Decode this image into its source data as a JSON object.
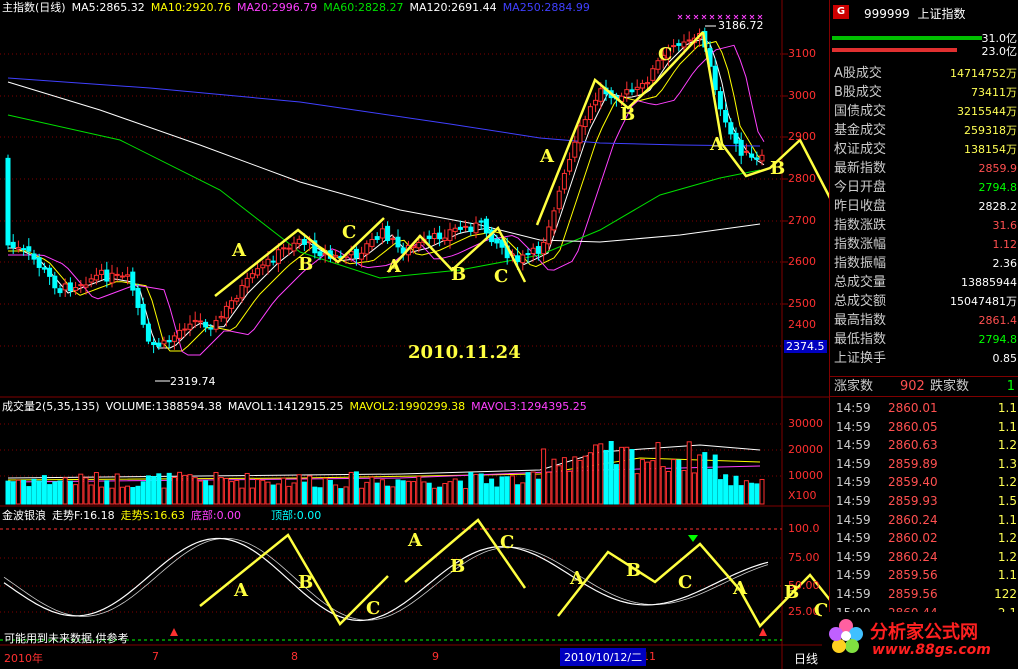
{
  "header": {
    "title": "主指数(日线)",
    "ma5": "MA5:2865.32",
    "ma10": "MA10:2920.76",
    "ma20": "MA20:2996.79",
    "ma60": "MA60:2828.27",
    "ma120": "MA120:2691.44",
    "ma250": "MA250:2884.99"
  },
  "price_axis": [
    "3100",
    "3000",
    "2900",
    "2800",
    "2700",
    "2600",
    "2500",
    "2400"
  ],
  "price_tag": "2374.5",
  "annotations": {
    "high": "3186.72",
    "low": "2319.74",
    "date": "2010.11.24",
    "wave_letters": [
      "A",
      "B",
      "C",
      "A",
      "B",
      "C",
      "A",
      "B",
      "A",
      "B",
      "C"
    ],
    "lower_letters": [
      "A",
      "B",
      "C",
      "A",
      "B",
      "C",
      "A",
      "B",
      "C",
      "A",
      "B",
      "C"
    ]
  },
  "volume": {
    "label": "成交量2(5,35,135)",
    "volume": "VOLUME:1388594.38",
    "mavol1": "MAVOL1:1412915.25",
    "mavol2": "MAVOL2:1990299.38",
    "mavol3": "MAVOL3:1294395.25",
    "axis": [
      "30000",
      "20000",
      "10000"
    ],
    "unit": "X100"
  },
  "indicator": {
    "label": "金波银浪",
    "trend_f": "走势F:16.18",
    "trend_s": "走势S:16.63",
    "bottom": "底部:0.00",
    "top": "顶部:0.00",
    "axis": [
      "100.0",
      "75.00",
      "50.00",
      "25.00"
    ],
    "note": "可能用到未来数据,供参考"
  },
  "time_axis": {
    "labels": [
      "2010年",
      "7",
      "8",
      "9",
      "11"
    ],
    "current": "2010/10/12/二",
    "mode": "日线"
  },
  "panel": {
    "code": "999999",
    "name": "上证指数",
    "badge": "G",
    "amount_up": "31.0亿",
    "amount_down": "23.0亿",
    "rows": [
      {
        "k": "A股成交",
        "v": "14714752万"
      },
      {
        "k": "B股成交",
        "v": "73411万"
      },
      {
        "k": "国债成交",
        "v": "3215544万"
      },
      {
        "k": "基金成交",
        "v": "259318万"
      },
      {
        "k": "权证成交",
        "v": "138154万"
      },
      {
        "k": "最新指数",
        "v": "2859.9"
      },
      {
        "k": "今日开盘",
        "v": "2794.8"
      },
      {
        "k": "昨日收盘",
        "v": "2828.2"
      },
      {
        "k": "指数涨跌",
        "v": "31.6"
      },
      {
        "k": "指数涨幅",
        "v": "1.12"
      },
      {
        "k": "指数振幅",
        "v": "2.36"
      },
      {
        "k": "总成交量",
        "v": "13885944"
      },
      {
        "k": "总成交额",
        "v": "15047481万"
      },
      {
        "k": "最高指数",
        "v": "2861.4"
      },
      {
        "k": "最低指数",
        "v": "2794.8"
      },
      {
        "k": "上证换手",
        "v": "0.85"
      }
    ],
    "up_label": "涨家数",
    "up_count": "902",
    "down_label": "跌家数",
    "down_count": "1",
    "ticks": [
      {
        "t": "14:59",
        "p": "2860.01",
        "q": "1.1"
      },
      {
        "t": "14:59",
        "p": "2860.05",
        "q": "1.1"
      },
      {
        "t": "14:59",
        "p": "2860.63",
        "q": "1.2"
      },
      {
        "t": "14:59",
        "p": "2859.89",
        "q": "1.3"
      },
      {
        "t": "14:59",
        "p": "2859.40",
        "q": "1.2"
      },
      {
        "t": "14:59",
        "p": "2859.93",
        "q": "1.5"
      },
      {
        "t": "14:59",
        "p": "2860.24",
        "q": "1.1"
      },
      {
        "t": "14:59",
        "p": "2860.02",
        "q": "1.2"
      },
      {
        "t": "14:59",
        "p": "2860.24",
        "q": "1.2"
      },
      {
        "t": "14:59",
        "p": "2859.56",
        "q": "1.1"
      },
      {
        "t": "14:59",
        "p": "2859.56",
        "q": "122"
      },
      {
        "t": "15:00",
        "p": "2860.44",
        "q": "2.1"
      }
    ]
  },
  "brand": {
    "name": "分析家公式网",
    "url": "www.88gs.com"
  },
  "colors": {
    "up": "#ff3030",
    "down": "#00ffff",
    "ma5": "#ffffff",
    "ma10": "#ffff00",
    "ma20": "#ff40ff",
    "ma60": "#00e000",
    "ma120": "#ffffff",
    "ma250": "#4040ff",
    "annotation": "#ffff40"
  }
}
